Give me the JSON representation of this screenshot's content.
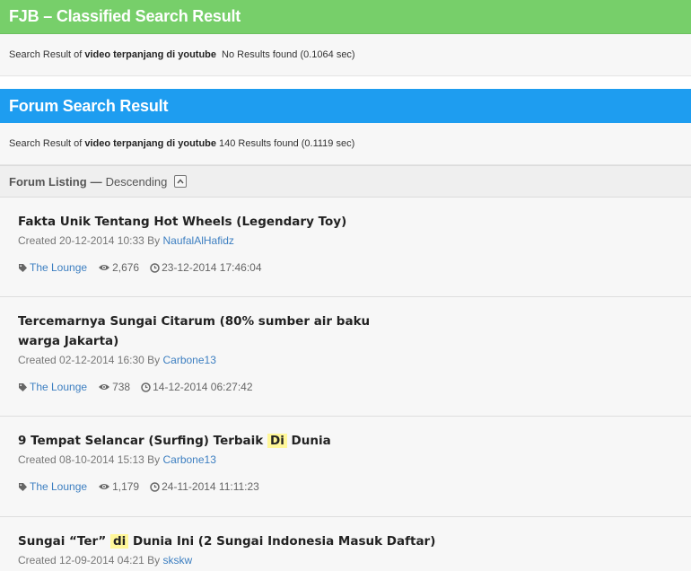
{
  "fjb": {
    "title": "FJB – Classified Search Result",
    "prefix": "Search Result of",
    "query": "video terpanjang di youtube",
    "result": "No Results found (0.1064 sec)"
  },
  "forum": {
    "title": "Forum Search Result",
    "prefix": "Search Result of",
    "query": "video terpanjang di youtube",
    "result": "140 Results found (0.1119 sec)"
  },
  "listing": {
    "title": "Forum Listing",
    "dash": "—",
    "order": "Descending"
  },
  "threads": [
    {
      "title": "Fakta Unik Tentang Hot Wheels (Legendary Toy)",
      "created_label": "Created",
      "created": "20-12-2014 10:33",
      "by_label": "By",
      "author": "NaufalAlHafidz",
      "category": "The Lounge",
      "views": "2,676",
      "last": "23-12-2014 17:46:04"
    },
    {
      "title": "Tercemarnya Sungai Citarum (80% sumber air baku warga Jakarta)",
      "created_label": "Created",
      "created": "02-12-2014 16:30",
      "by_label": "By",
      "author": "Carbone13",
      "category": "The Lounge",
      "views": "738",
      "last": "14-12-2014 06:27:42"
    },
    {
      "title_before": "9 Tempat Selancar (Surfing) Terbaik",
      "title_hl": "Di",
      "title_after": "Dunia",
      "created_label": "Created",
      "created": "08-10-2014 15:13",
      "by_label": "By",
      "author": "Carbone13",
      "category": "The Lounge",
      "views": "1,179",
      "last": "24-11-2014 11:11:23"
    },
    {
      "title_before": "Sungai “Ter”",
      "title_hl": "di",
      "title_after": "Dunia Ini (2 Sungai Indonesia Masuk Daftar)",
      "created_label": "Created",
      "created": "12-09-2014 04:21",
      "by_label": "By",
      "author": "skskw"
    }
  ],
  "colors": {
    "fjb_bar": "#77cf6a",
    "forum_bar": "#1e9df0",
    "link": "#3d7fc1",
    "highlight": "#fff799"
  },
  "icons": [
    "tag-icon",
    "eye-icon",
    "clock-icon",
    "chevron-up-icon"
  ]
}
